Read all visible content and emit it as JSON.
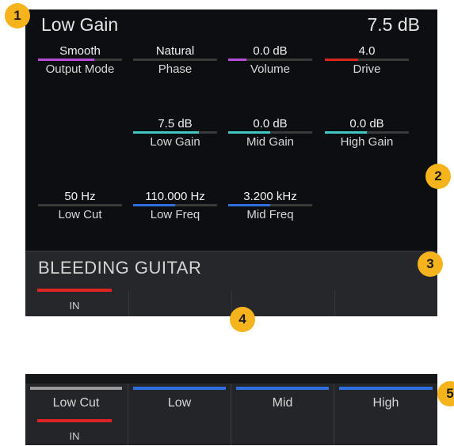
{
  "header": {
    "title": "Low Gain",
    "value": "7.5 dB"
  },
  "params": [
    {
      "value": "Smooth",
      "label": "Output Mode",
      "color": "#b84fd6",
      "level": 0.67
    },
    {
      "value": "Natural",
      "label": "Phase",
      "color": "#555555",
      "level": 0
    },
    {
      "value": "0.0 dB",
      "label": "Volume",
      "color": "#b84fd6",
      "level": 0.22
    },
    {
      "value": "4.0",
      "label": "Drive",
      "color": "#d9291c",
      "level": 0.4
    },
    {
      "value": "7.5 dB",
      "label": "Low Gain",
      "color": "#3fc8c4",
      "level": 0.78
    },
    {
      "value": "0.0 dB",
      "label": "Mid Gain",
      "color": "#3fc8c4",
      "level": 0.5
    },
    {
      "value": "0.0 dB",
      "label": "High Gain",
      "color": "#3fc8c4",
      "level": 0.5
    },
    {
      "value": "50 Hz",
      "label": "Low Cut",
      "color": "#555555",
      "level": 0
    },
    {
      "value": "110.000 Hz",
      "label": "Low Freq",
      "color": "#2f6fe0",
      "level": 0.5
    },
    {
      "value": "3.200 kHz",
      "label": "Mid Freq",
      "color": "#2f6fe0",
      "level": 0.5
    }
  ],
  "panel": {
    "title": "BLEEDING GUITAR",
    "in_label": "IN"
  },
  "strip": {
    "tabs": [
      {
        "label": "Low Cut",
        "color": "#9a9a9a"
      },
      {
        "label": "Low",
        "color": "#2f6fe0"
      },
      {
        "label": "Mid",
        "color": "#2f6fe0"
      },
      {
        "label": "High",
        "color": "#2f6fe0"
      }
    ],
    "in_label": "IN"
  },
  "badges": [
    "1",
    "2",
    "3",
    "4",
    "5"
  ],
  "accent": {
    "badge": "#f5b31c",
    "in_red": "#e02424"
  }
}
